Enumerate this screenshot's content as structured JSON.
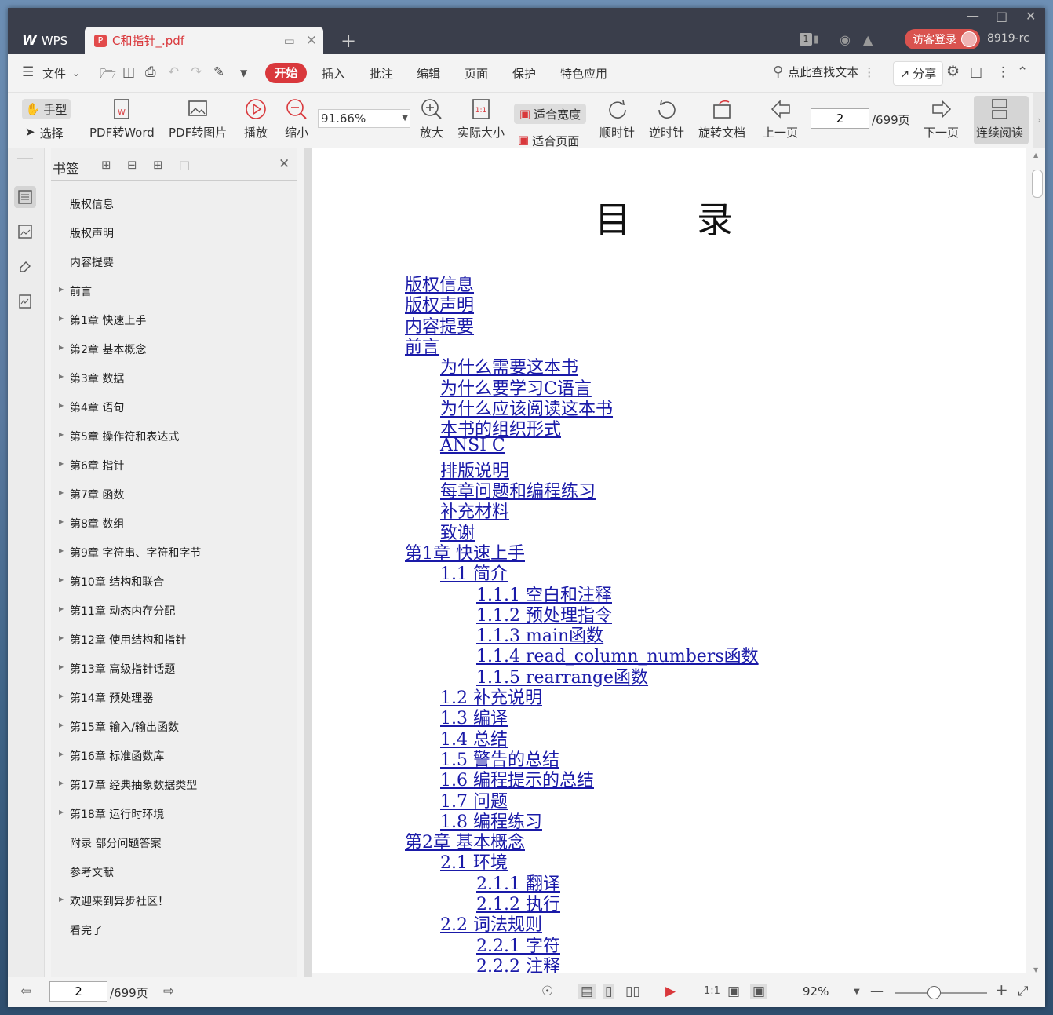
{
  "titlebar": {
    "app_label": "WPS",
    "doc_tab_name": "C和指针_.pdf",
    "badge_count": "1",
    "login_label": "访客登录",
    "user_code": "8919-rc"
  },
  "menubar": {
    "file_label": "文件",
    "active_tab": "开始",
    "tabs": [
      "插入",
      "批注",
      "编辑",
      "页面",
      "保护",
      "特色应用"
    ],
    "search_label": "点此查找文本",
    "share_label": "分享"
  },
  "toolbar": {
    "hand_label": "手型",
    "select_label": "选择",
    "pdf_to_word": "PDF转Word",
    "pdf_to_image": "PDF转图片",
    "play": "播放",
    "zoom_out": "缩小",
    "zoom_value": "91.66%",
    "zoom_in": "放大",
    "actual_size": "实际大小",
    "fit_width": "适合宽度",
    "fit_page": "适合页面",
    "rotate_cw": "顺时针",
    "rotate_ccw": "逆时针",
    "rotate_doc": "旋转文档",
    "prev_page": "上一页",
    "page_value": "2",
    "page_total": "/699页",
    "next_page": "下一页",
    "continuous_read": "连续阅读"
  },
  "bookmarks": {
    "title": "书签",
    "items": [
      {
        "label": "版权信息",
        "expandable": false
      },
      {
        "label": "版权声明",
        "expandable": false
      },
      {
        "label": "内容提要",
        "expandable": false
      },
      {
        "label": "前言",
        "expandable": true
      },
      {
        "label": "第1章 快速上手",
        "expandable": true
      },
      {
        "label": "第2章 基本概念",
        "expandable": true
      },
      {
        "label": "第3章 数据",
        "expandable": true
      },
      {
        "label": "第4章 语句",
        "expandable": true
      },
      {
        "label": "第5章 操作符和表达式",
        "expandable": true
      },
      {
        "label": "第6章 指针",
        "expandable": true
      },
      {
        "label": "第7章 函数",
        "expandable": true
      },
      {
        "label": "第8章 数组",
        "expandable": true
      },
      {
        "label": "第9章 字符串、字符和字节",
        "expandable": true
      },
      {
        "label": "第10章 结构和联合",
        "expandable": true
      },
      {
        "label": "第11章 动态内存分配",
        "expandable": true
      },
      {
        "label": "第12章 使用结构和指针",
        "expandable": true
      },
      {
        "label": "第13章 高级指针话题",
        "expandable": true
      },
      {
        "label": "第14章 预处理器",
        "expandable": true
      },
      {
        "label": "第15章 输入/输出函数",
        "expandable": true
      },
      {
        "label": "第16章 标准函数库",
        "expandable": true
      },
      {
        "label": "第17章 经典抽象数据类型",
        "expandable": true
      },
      {
        "label": "第18章 运行时环境",
        "expandable": true
      },
      {
        "label": "附录 部分问题答案",
        "expandable": false
      },
      {
        "label": "参考文献",
        "expandable": false
      },
      {
        "label": "欢迎来到异步社区！",
        "expandable": true
      },
      {
        "label": "看完了",
        "expandable": false
      }
    ]
  },
  "document": {
    "title": "目录",
    "toc": [
      {
        "text": "版权信息",
        "level": 0
      },
      {
        "text": "版权声明",
        "level": 0
      },
      {
        "text": "内容提要",
        "level": 0
      },
      {
        "text": "前言",
        "level": 0
      },
      {
        "text": "为什么需要这本书",
        "level": 1
      },
      {
        "text": "为什么要学习C语言",
        "level": 1
      },
      {
        "text": "为什么应该阅读这本书",
        "level": 1
      },
      {
        "text": "本书的组织形式",
        "level": 1
      },
      {
        "text": "ANSI C",
        "level": 1
      },
      {
        "text": "排版说明",
        "level": 1
      },
      {
        "text": "每章问题和编程练习",
        "level": 1
      },
      {
        "text": "补充材料",
        "level": 1
      },
      {
        "text": "致谢",
        "level": 1
      },
      {
        "text": "第1章 快速上手",
        "level": 0
      },
      {
        "text": "1.1 简介",
        "level": 1
      },
      {
        "text": "1.1.1 空白和注释",
        "level": 2
      },
      {
        "text": "1.1.2 预处理指令",
        "level": 2
      },
      {
        "text": "1.1.3 main函数",
        "level": 2
      },
      {
        "text": "1.1.4 read_column_numbers函数",
        "level": 2
      },
      {
        "text": "1.1.5 rearrange函数",
        "level": 2
      },
      {
        "text": "1.2 补充说明",
        "level": 1
      },
      {
        "text": "1.3 编译",
        "level": 1
      },
      {
        "text": "1.4 总结",
        "level": 1
      },
      {
        "text": "1.5 警告的总结",
        "level": 1
      },
      {
        "text": "1.6 编程提示的总结",
        "level": 1
      },
      {
        "text": "1.7 问题",
        "level": 1
      },
      {
        "text": "1.8 编程练习",
        "level": 1
      },
      {
        "text": "第2章 基本概念",
        "level": 0
      },
      {
        "text": "2.1 环境",
        "level": 1
      },
      {
        "text": "2.1.1 翻译",
        "level": 2
      },
      {
        "text": "2.1.2 执行",
        "level": 2
      },
      {
        "text": "2.2 词法规则",
        "level": 1
      },
      {
        "text": "2.2.1 字符",
        "level": 2
      },
      {
        "text": "2.2.2 注释",
        "level": 2
      }
    ]
  },
  "statusbar": {
    "page_value": "2",
    "page_total": "/699页",
    "zoom_value": "92%"
  },
  "colors": {
    "accent": "#d9383c",
    "link": "#1a1aa8",
    "titlebar": "#3a3e4b"
  }
}
